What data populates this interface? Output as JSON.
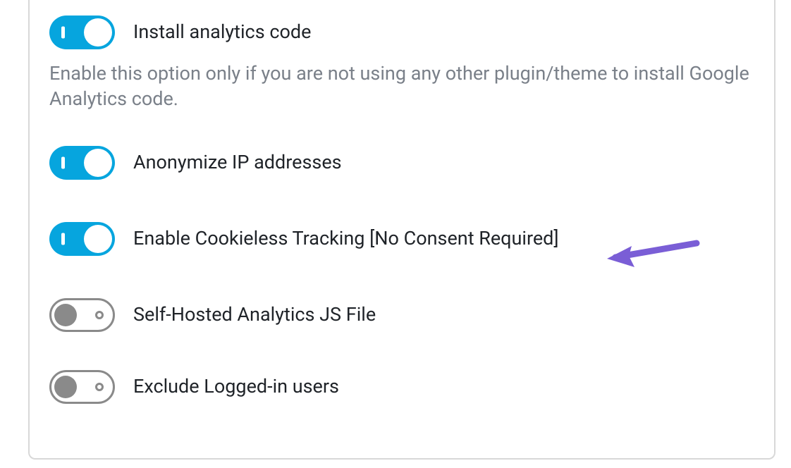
{
  "options": {
    "install_analytics": {
      "label": "Install analytics code",
      "description": "Enable this option only if you are not using any other plugin/theme to install Google Analytics code.",
      "enabled": true
    },
    "anonymize_ip": {
      "label": "Anonymize IP addresses",
      "enabled": true
    },
    "cookieless_tracking": {
      "label": "Enable Cookieless Tracking [No Consent Required]",
      "enabled": true
    },
    "self_hosted_js": {
      "label": "Self-Hosted Analytics JS File",
      "enabled": false
    },
    "exclude_logged_in": {
      "label": "Exclude Logged-in users",
      "enabled": false
    }
  },
  "annotation": {
    "arrow_color": "#7a5ed6"
  }
}
